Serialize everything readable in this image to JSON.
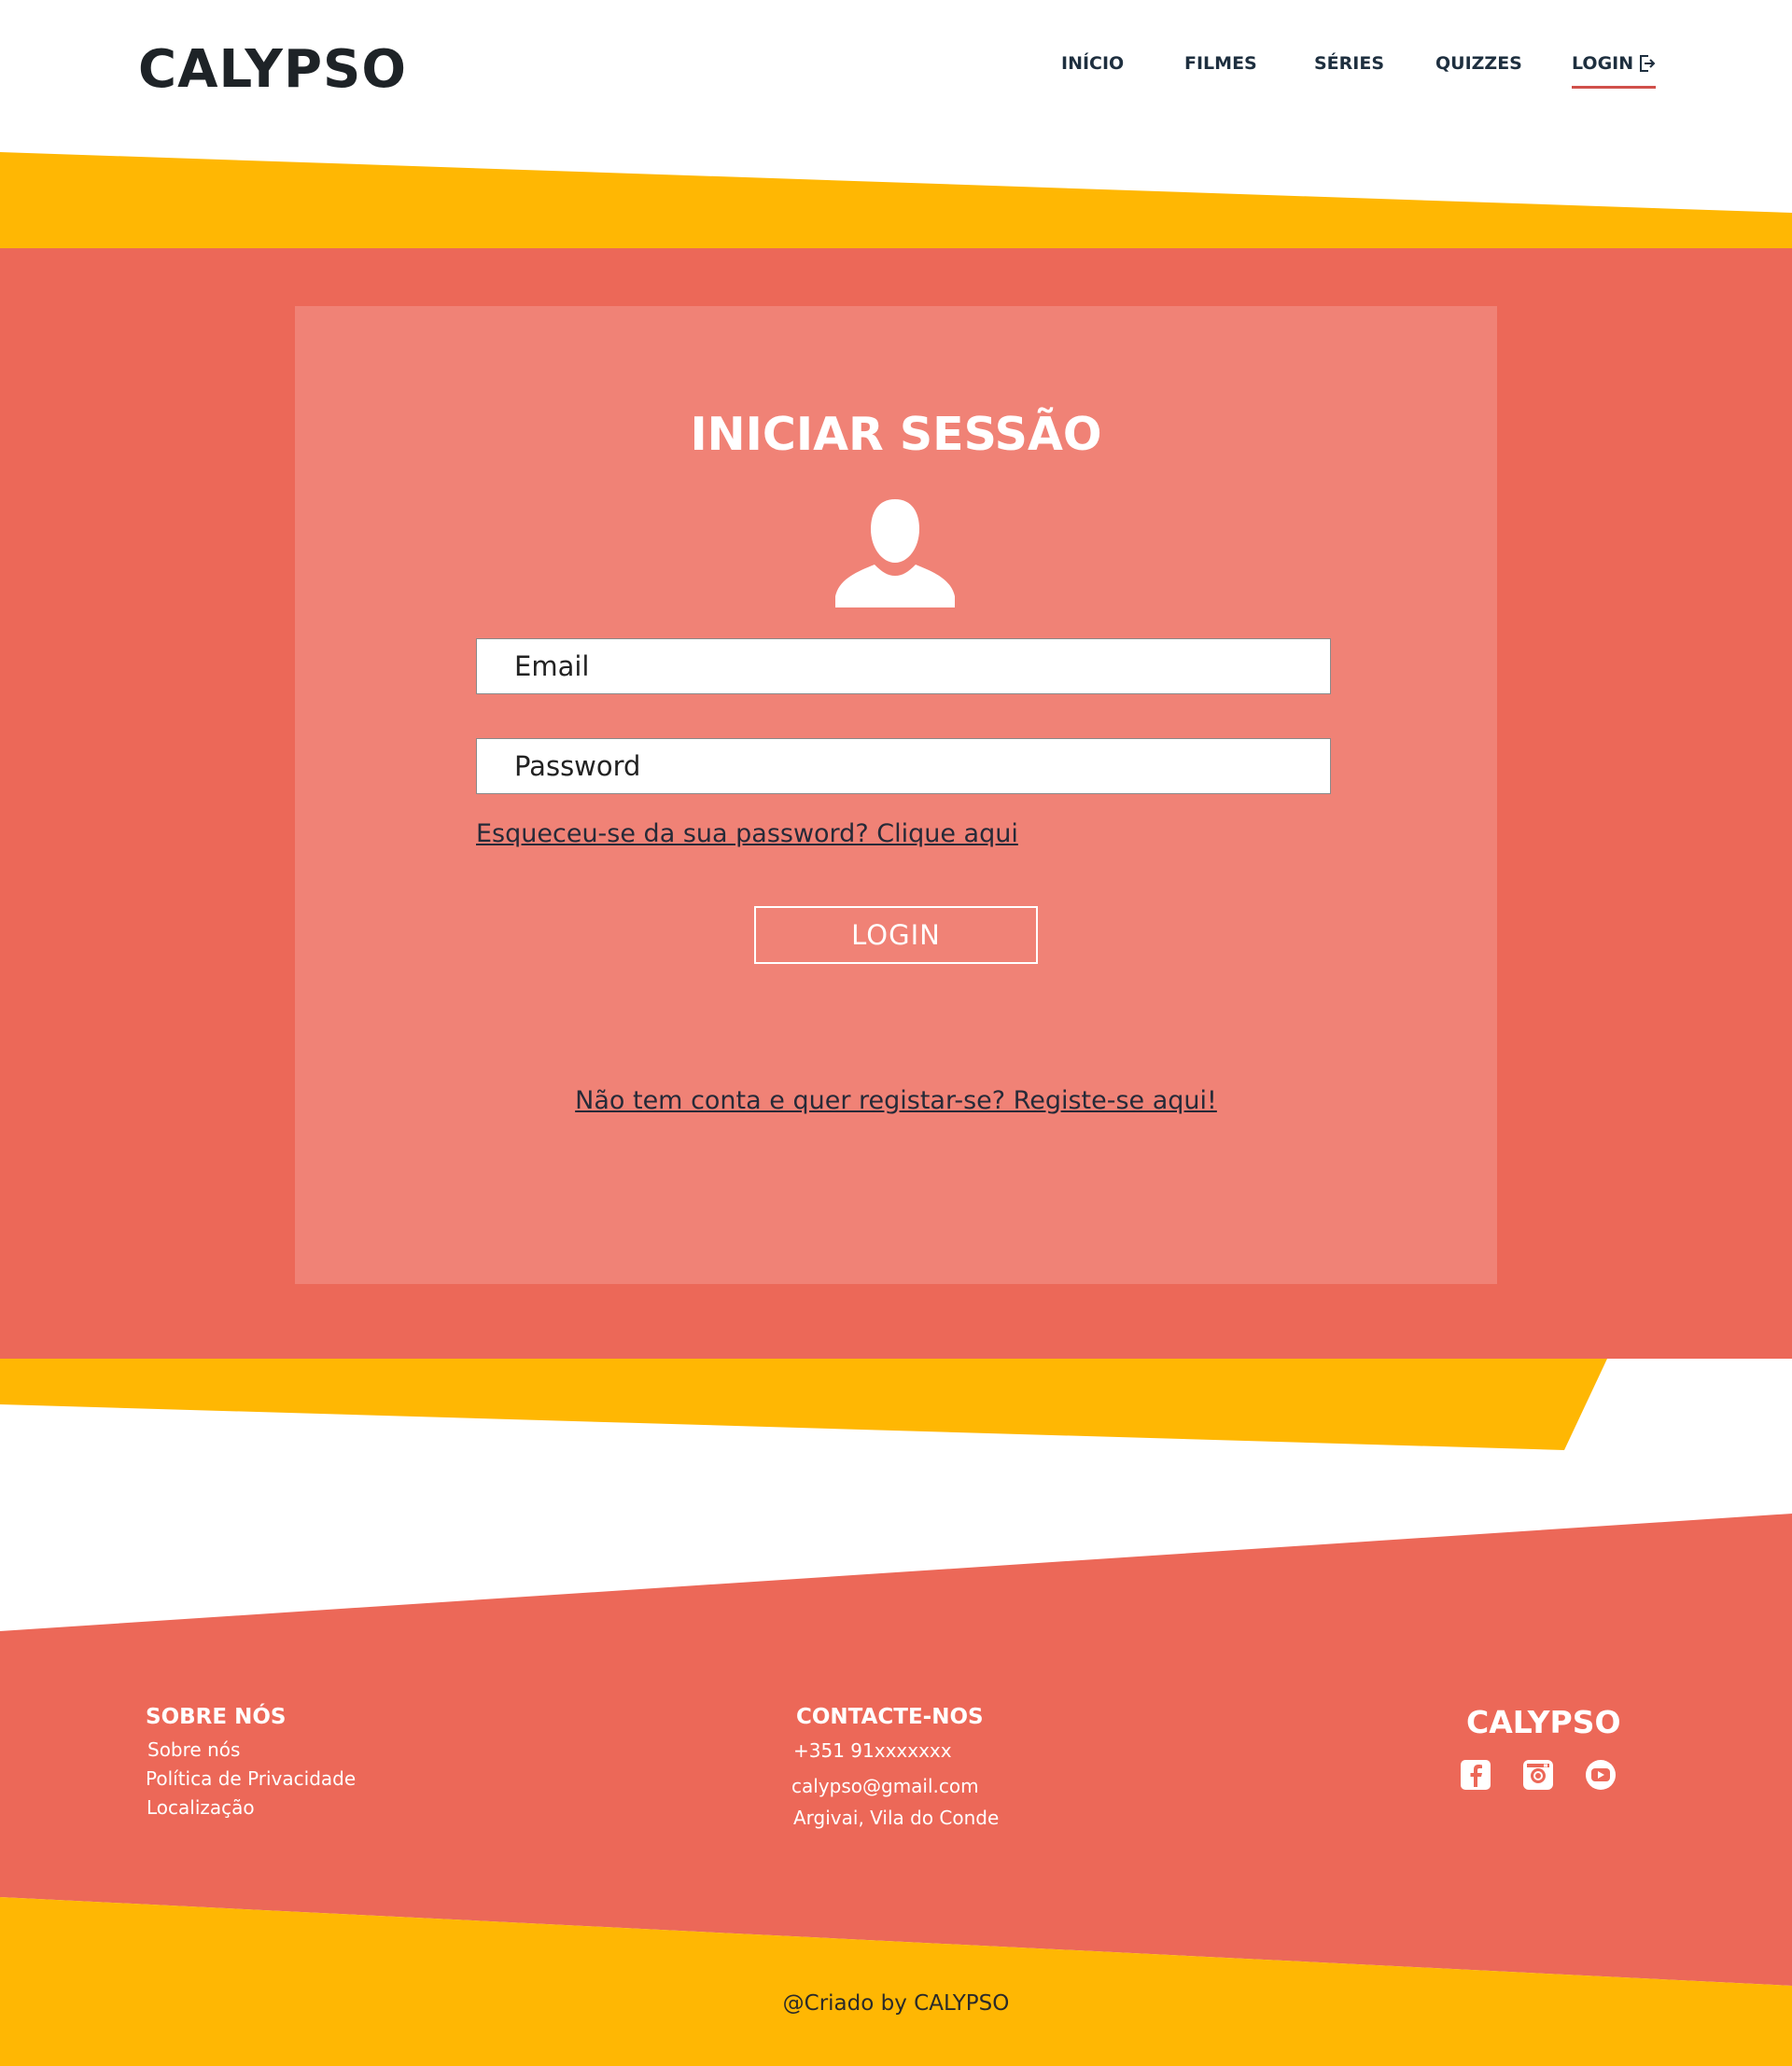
{
  "brand": "CALYPSO",
  "colors": {
    "accent_red": "#ec6858",
    "card": "#f08276",
    "yellow": "#ffb703",
    "text_dark": "#1e2327"
  },
  "nav": {
    "items": [
      "INÍCIO",
      "FILMES",
      "SÉRIES",
      "QUIZZES"
    ],
    "login": "LOGIN",
    "login_icon": "sign-in-icon"
  },
  "login_form": {
    "title": "INICIAR SESSÃO",
    "avatar_icon": "user-icon",
    "email_placeholder": "Email",
    "password_placeholder": "Password",
    "forgot_link": "Esqueceu-se da sua password? Clique aqui",
    "login_button": "LOGIN",
    "register_link": "Não tem conta e quer registar-se? Registe-se aqui!"
  },
  "footer": {
    "about": {
      "heading": "SOBRE NÓS",
      "links": [
        "Sobre nós",
        "Política de Privacidade",
        "Localização"
      ]
    },
    "contact": {
      "heading": "CONTACTE-NOS",
      "phone": "+351 91xxxxxxx",
      "email": "calypso@gmail.com",
      "address": "Argivai, Vila do Conde"
    },
    "brand": "CALYPSO",
    "social_icons": [
      "facebook-icon",
      "instagram-icon",
      "youtube-icon"
    ],
    "copyright": "@Criado by CALYPSO"
  }
}
